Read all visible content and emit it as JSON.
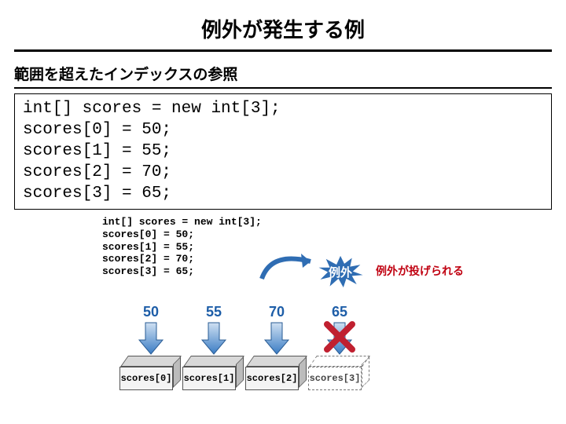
{
  "title": "例外が発生する例",
  "subtitle": "範囲を超えたインデックスの参照",
  "code_main": "int[] scores = new int[3];\nscores[0] = 50;\nscores[1] = 55;\nscores[2] = 70;\nscores[3] = 65;",
  "code_small": "int[] scores = new int[3];\nscores[0] = 50;\nscores[1] = 55;\nscores[2] = 70;\nscores[3] = 65;",
  "burst_label": "例外",
  "thrown_label": "例外が投げられる",
  "values": [
    "50",
    "55",
    "70",
    "65"
  ],
  "slots": [
    "scores[0]",
    "scores[1]",
    "scores[2]",
    "scores[3]"
  ],
  "colors": {
    "value_text": "#1e5ea8",
    "error_text": "#c00010",
    "arrow_blue": "#3a7cc4",
    "burst_fill": "#2f6db3",
    "cross": "#c02030"
  }
}
